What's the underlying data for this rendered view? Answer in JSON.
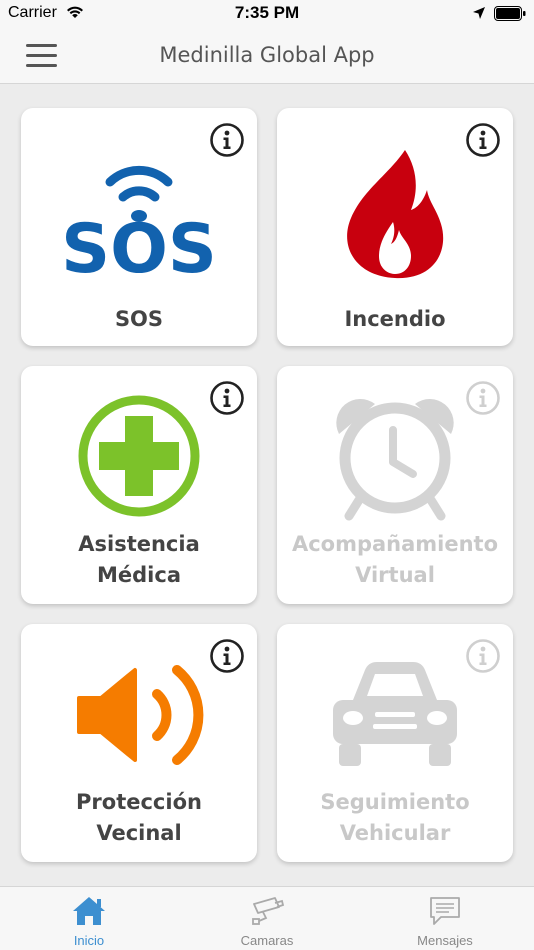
{
  "status_bar": {
    "carrier": "Carrier",
    "time": "7:35 PM"
  },
  "nav": {
    "title": "Medinilla Global App"
  },
  "tiles": [
    {
      "label_lines": [
        "SOS"
      ],
      "enabled": true
    },
    {
      "label_lines": [
        "Incendio"
      ],
      "enabled": true
    },
    {
      "label_lines": [
        "Asistencia",
        "Médica"
      ],
      "enabled": true
    },
    {
      "label_lines": [
        "Acompañamiento",
        "Virtual"
      ],
      "enabled": false
    },
    {
      "label_lines": [
        "Protección",
        "Vecinal"
      ],
      "enabled": true
    },
    {
      "label_lines": [
        "Seguimiento",
        "Vehicular"
      ],
      "enabled": false
    }
  ],
  "sos_icon_text": "SOS",
  "tabs": [
    {
      "label": "Inicio",
      "icon": "home-icon",
      "active": true
    },
    {
      "label": "Camaras",
      "icon": "camera-icon",
      "active": false
    },
    {
      "label": "Mensajes",
      "icon": "message-icon",
      "active": false
    }
  ],
  "colors": {
    "sos_blue": "#1262ae",
    "fire_red": "#c8000e",
    "medical_green": "#7cc22a",
    "alarm_orange": "#f57c00",
    "disabled_gray": "#d4d4d4",
    "active_tab": "#3d8fd0"
  }
}
